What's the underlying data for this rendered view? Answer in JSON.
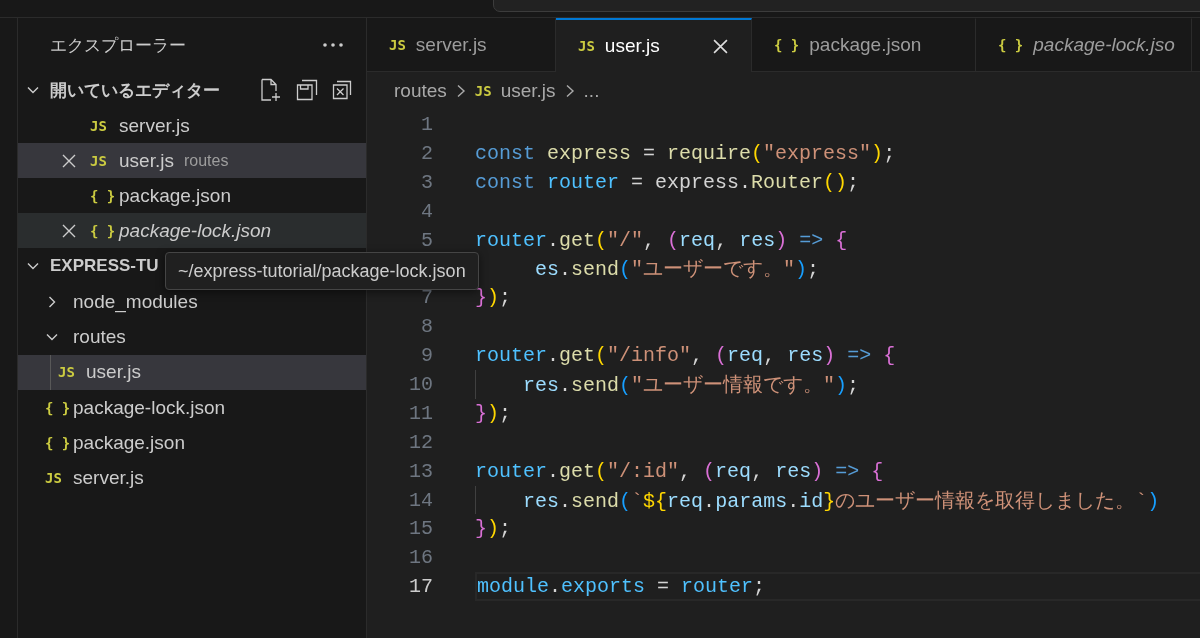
{
  "sidebar": {
    "title": "エクスプローラー",
    "open_editors": {
      "title": "開いているエディター",
      "expanded": true,
      "items": [
        {
          "icon": "JS",
          "name": "server.js",
          "selected": false,
          "hovered": false,
          "preview": false
        },
        {
          "icon": "JS",
          "name": "user.js",
          "description": "routes",
          "selected": true,
          "hovered": false,
          "preview": false
        },
        {
          "icon": "{ }",
          "name": "package.json",
          "selected": false,
          "hovered": false,
          "preview": false
        },
        {
          "icon": "{ }",
          "name": "package-lock.json",
          "selected": false,
          "hovered": true,
          "preview": true
        }
      ]
    },
    "explorer": {
      "title": "EXPRESS-TU",
      "expanded": true,
      "tree": [
        {
          "kind": "folder",
          "name": "node_modules",
          "expanded": false,
          "selected": false
        },
        {
          "kind": "folder",
          "name": "routes",
          "expanded": true,
          "selected": false,
          "children": [
            {
              "kind": "file",
              "icon": "JS",
              "name": "user.js",
              "selected": true
            }
          ]
        },
        {
          "kind": "file",
          "icon": "{ }",
          "name": "package-lock.json",
          "selected": false
        },
        {
          "kind": "file",
          "icon": "{ }",
          "name": "package.json",
          "selected": false
        },
        {
          "kind": "file",
          "icon": "JS",
          "name": "server.js",
          "selected": false
        }
      ]
    }
  },
  "tooltip": "~/express-tutorial/package-lock.json",
  "tabs": [
    {
      "icon": "JS",
      "label": "server.js",
      "selected": false,
      "preview": false
    },
    {
      "icon": "JS",
      "label": "user.js",
      "selected": true,
      "preview": false
    },
    {
      "icon": "{ }",
      "label": "package.json",
      "selected": false,
      "preview": false
    },
    {
      "icon": "{ }",
      "label": "package-lock.jso",
      "selected": false,
      "preview": true
    }
  ],
  "breadcrumb": [
    {
      "label": "routes"
    },
    {
      "icon": "JS",
      "label": "user.js"
    },
    {
      "label": "..."
    }
  ],
  "code": [
    {
      "number": "1",
      "current": false
    },
    {
      "number": "2",
      "current": false,
      "tokens": [
        {
          "kind": "kw",
          "t": "const "
        },
        {
          "kind": "fn",
          "t": "express"
        },
        {
          "kind": "p",
          "t": " = "
        },
        {
          "kind": "fn",
          "t": "require"
        },
        {
          "kind": "b1",
          "t": "("
        },
        {
          "kind": "str",
          "t": "\"express\""
        },
        {
          "kind": "b1",
          "t": ")"
        },
        {
          "kind": "p",
          "t": ";"
        }
      ]
    },
    {
      "number": "3",
      "current": false,
      "tokens": [
        {
          "kind": "kw",
          "t": "const "
        },
        {
          "kind": "cv",
          "t": "router"
        },
        {
          "kind": "p",
          "t": " = express."
        },
        {
          "kind": "fn",
          "t": "Router"
        },
        {
          "kind": "b1",
          "t": "()"
        },
        {
          "kind": "p",
          "t": ";"
        }
      ]
    },
    {
      "number": "4",
      "current": false
    },
    {
      "number": "5",
      "current": false,
      "tokens": [
        {
          "kind": "cv",
          "t": "router"
        },
        {
          "kind": "p",
          "t": "."
        },
        {
          "kind": "fn",
          "t": "get"
        },
        {
          "kind": "b1",
          "t": "("
        },
        {
          "kind": "str",
          "t": "\"/\""
        },
        {
          "kind": "p",
          "t": ", "
        },
        {
          "kind": "b2",
          "t": "("
        },
        {
          "kind": "par",
          "t": "req"
        },
        {
          "kind": "p",
          "t": ", "
        },
        {
          "kind": "par",
          "t": "res"
        },
        {
          "kind": "b2",
          "t": ")"
        },
        {
          "kind": "kw",
          "t": " => "
        },
        {
          "kind": "b2",
          "t": "{"
        }
      ]
    },
    {
      "current": false,
      "tokens": [
        {
          "kind": "par",
          "t": "     es"
        },
        {
          "kind": "p",
          "t": "."
        },
        {
          "kind": "fn",
          "t": "send"
        },
        {
          "kind": "b3",
          "t": "("
        },
        {
          "kind": "str",
          "t": "\"ユーザーです。\""
        },
        {
          "kind": "b3",
          "t": ")"
        },
        {
          "kind": "p",
          "t": ";"
        }
      ]
    },
    {
      "number": "7",
      "current": false,
      "tokens": [
        {
          "kind": "b2",
          "t": "}"
        },
        {
          "kind": "b1",
          "t": ")"
        },
        {
          "kind": "p",
          "t": ";"
        }
      ]
    },
    {
      "number": "8",
      "current": false
    },
    {
      "number": "9",
      "current": false,
      "tokens": [
        {
          "kind": "cv",
          "t": "router"
        },
        {
          "kind": "p",
          "t": "."
        },
        {
          "kind": "fn",
          "t": "get"
        },
        {
          "kind": "b1",
          "t": "("
        },
        {
          "kind": "str",
          "t": "\"/info\""
        },
        {
          "kind": "p",
          "t": ", "
        },
        {
          "kind": "b2",
          "t": "("
        },
        {
          "kind": "par",
          "t": "req"
        },
        {
          "kind": "p",
          "t": ", "
        },
        {
          "kind": "par",
          "t": "res"
        },
        {
          "kind": "b2",
          "t": ")"
        },
        {
          "kind": "kw",
          "t": " => "
        },
        {
          "kind": "b2",
          "t": "{"
        }
      ]
    },
    {
      "number": "10",
      "current": false,
      "tokens": [
        {
          "kind": "par",
          "t": "    res"
        },
        {
          "kind": "p",
          "t": "."
        },
        {
          "kind": "fn",
          "t": "send"
        },
        {
          "kind": "b3",
          "t": "("
        },
        {
          "kind": "str",
          "t": "\"ユーザー情報です。\""
        },
        {
          "kind": "b3",
          "t": ")"
        },
        {
          "kind": "p",
          "t": ";"
        }
      ]
    },
    {
      "number": "11",
      "current": false,
      "tokens": [
        {
          "kind": "b2",
          "t": "}"
        },
        {
          "kind": "b1",
          "t": ")"
        },
        {
          "kind": "p",
          "t": ";"
        }
      ]
    },
    {
      "number": "12",
      "current": false
    },
    {
      "number": "13",
      "current": false,
      "tokens": [
        {
          "kind": "cv",
          "t": "router"
        },
        {
          "kind": "p",
          "t": "."
        },
        {
          "kind": "fn",
          "t": "get"
        },
        {
          "kind": "b1",
          "t": "("
        },
        {
          "kind": "str",
          "t": "\"/:id\""
        },
        {
          "kind": "p",
          "t": ", "
        },
        {
          "kind": "b2",
          "t": "("
        },
        {
          "kind": "par",
          "t": "req"
        },
        {
          "kind": "p",
          "t": ", "
        },
        {
          "kind": "par",
          "t": "res"
        },
        {
          "kind": "b2",
          "t": ")"
        },
        {
          "kind": "kw",
          "t": " => "
        },
        {
          "kind": "b2",
          "t": "{"
        }
      ]
    },
    {
      "number": "14",
      "current": false,
      "tokens": [
        {
          "kind": "par",
          "t": "    res"
        },
        {
          "kind": "p",
          "t": "."
        },
        {
          "kind": "fn",
          "t": "send"
        },
        {
          "kind": "b3",
          "t": "("
        },
        {
          "kind": "str",
          "t": "`"
        },
        {
          "kind": "b1",
          "t": "${"
        },
        {
          "kind": "par",
          "t": "req"
        },
        {
          "kind": "p",
          "t": "."
        },
        {
          "kind": "par",
          "t": "params"
        },
        {
          "kind": "p",
          "t": "."
        },
        {
          "kind": "par",
          "t": "id"
        },
        {
          "kind": "b1",
          "t": "}"
        },
        {
          "kind": "str",
          "t": "のユーザー情報を取得しました。`"
        },
        {
          "kind": "b3",
          "t": ")"
        }
      ]
    },
    {
      "number": "15",
      "current": false,
      "tokens": [
        {
          "kind": "b2",
          "t": "}"
        },
        {
          "kind": "b1",
          "t": ")"
        },
        {
          "kind": "p",
          "t": ";"
        }
      ]
    },
    {
      "number": "16",
      "current": false
    },
    {
      "number": "17",
      "current": true,
      "tokens": [
        {
          "kind": "cv",
          "t": "module"
        },
        {
          "kind": "p",
          "t": "."
        },
        {
          "kind": "cv",
          "t": "exports"
        },
        {
          "kind": "p",
          "t": " = "
        },
        {
          "kind": "cv",
          "t": "router"
        },
        {
          "kind": "p",
          "t": ";"
        }
      ]
    }
  ]
}
